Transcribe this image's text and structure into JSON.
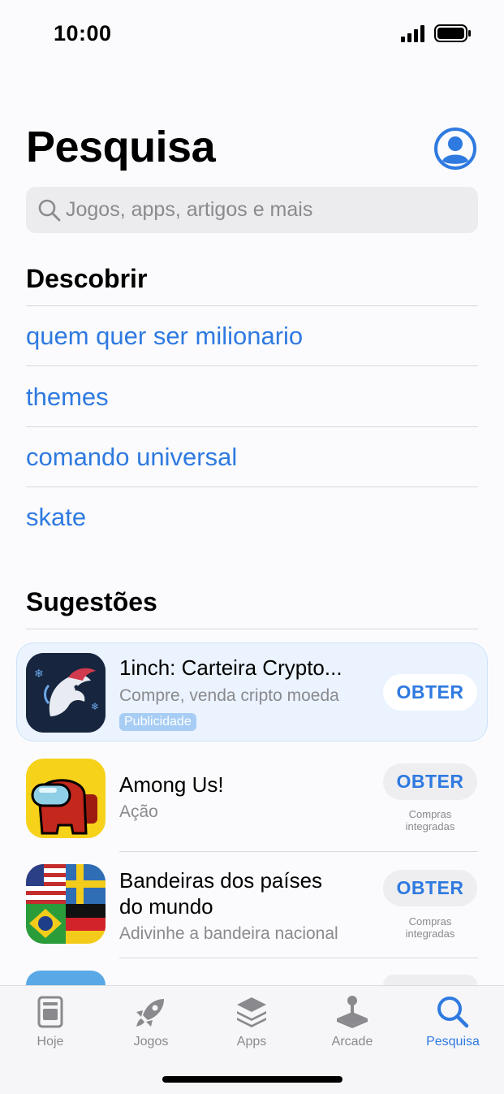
{
  "status_bar": {
    "time": "10:00"
  },
  "header": {
    "title": "Pesquisa"
  },
  "search": {
    "placeholder": "Jogos, apps, artigos e mais"
  },
  "discover": {
    "title": "Descobrir",
    "items": [
      "quem quer ser milionario",
      "themes",
      "comando universal",
      "skate"
    ]
  },
  "suggestions": {
    "title": "Sugestões",
    "items": [
      {
        "title": "1inch: Carteira Crypto...",
        "subtitle": "Compre, venda cripto moeda",
        "badge": "Publicidade",
        "button": "OBTER",
        "icon": "unicorn-icon"
      },
      {
        "title": "Among Us!",
        "subtitle": "Ação",
        "button": "OBTER",
        "note1": "Compras",
        "note2": "integradas",
        "icon": "crewmate-icon"
      },
      {
        "title_line1": "Bandeiras dos países",
        "title_line2": "do mundo",
        "subtitle": "Adivinhe a bandeira nacional",
        "button": "OBTER",
        "note1": "Compras",
        "note2": "integradas",
        "icon": "flags-icon"
      }
    ]
  },
  "tabs": [
    {
      "label": "Hoje",
      "icon": "today-icon"
    },
    {
      "label": "Jogos",
      "icon": "rocket-icon"
    },
    {
      "label": "Apps",
      "icon": "layers-icon"
    },
    {
      "label": "Arcade",
      "icon": "joystick-icon"
    },
    {
      "label": "Pesquisa",
      "icon": "search-icon",
      "active": true
    }
  ],
  "colors": {
    "accent": "#2f7ae0",
    "secondary_text": "#8a8a8e"
  }
}
